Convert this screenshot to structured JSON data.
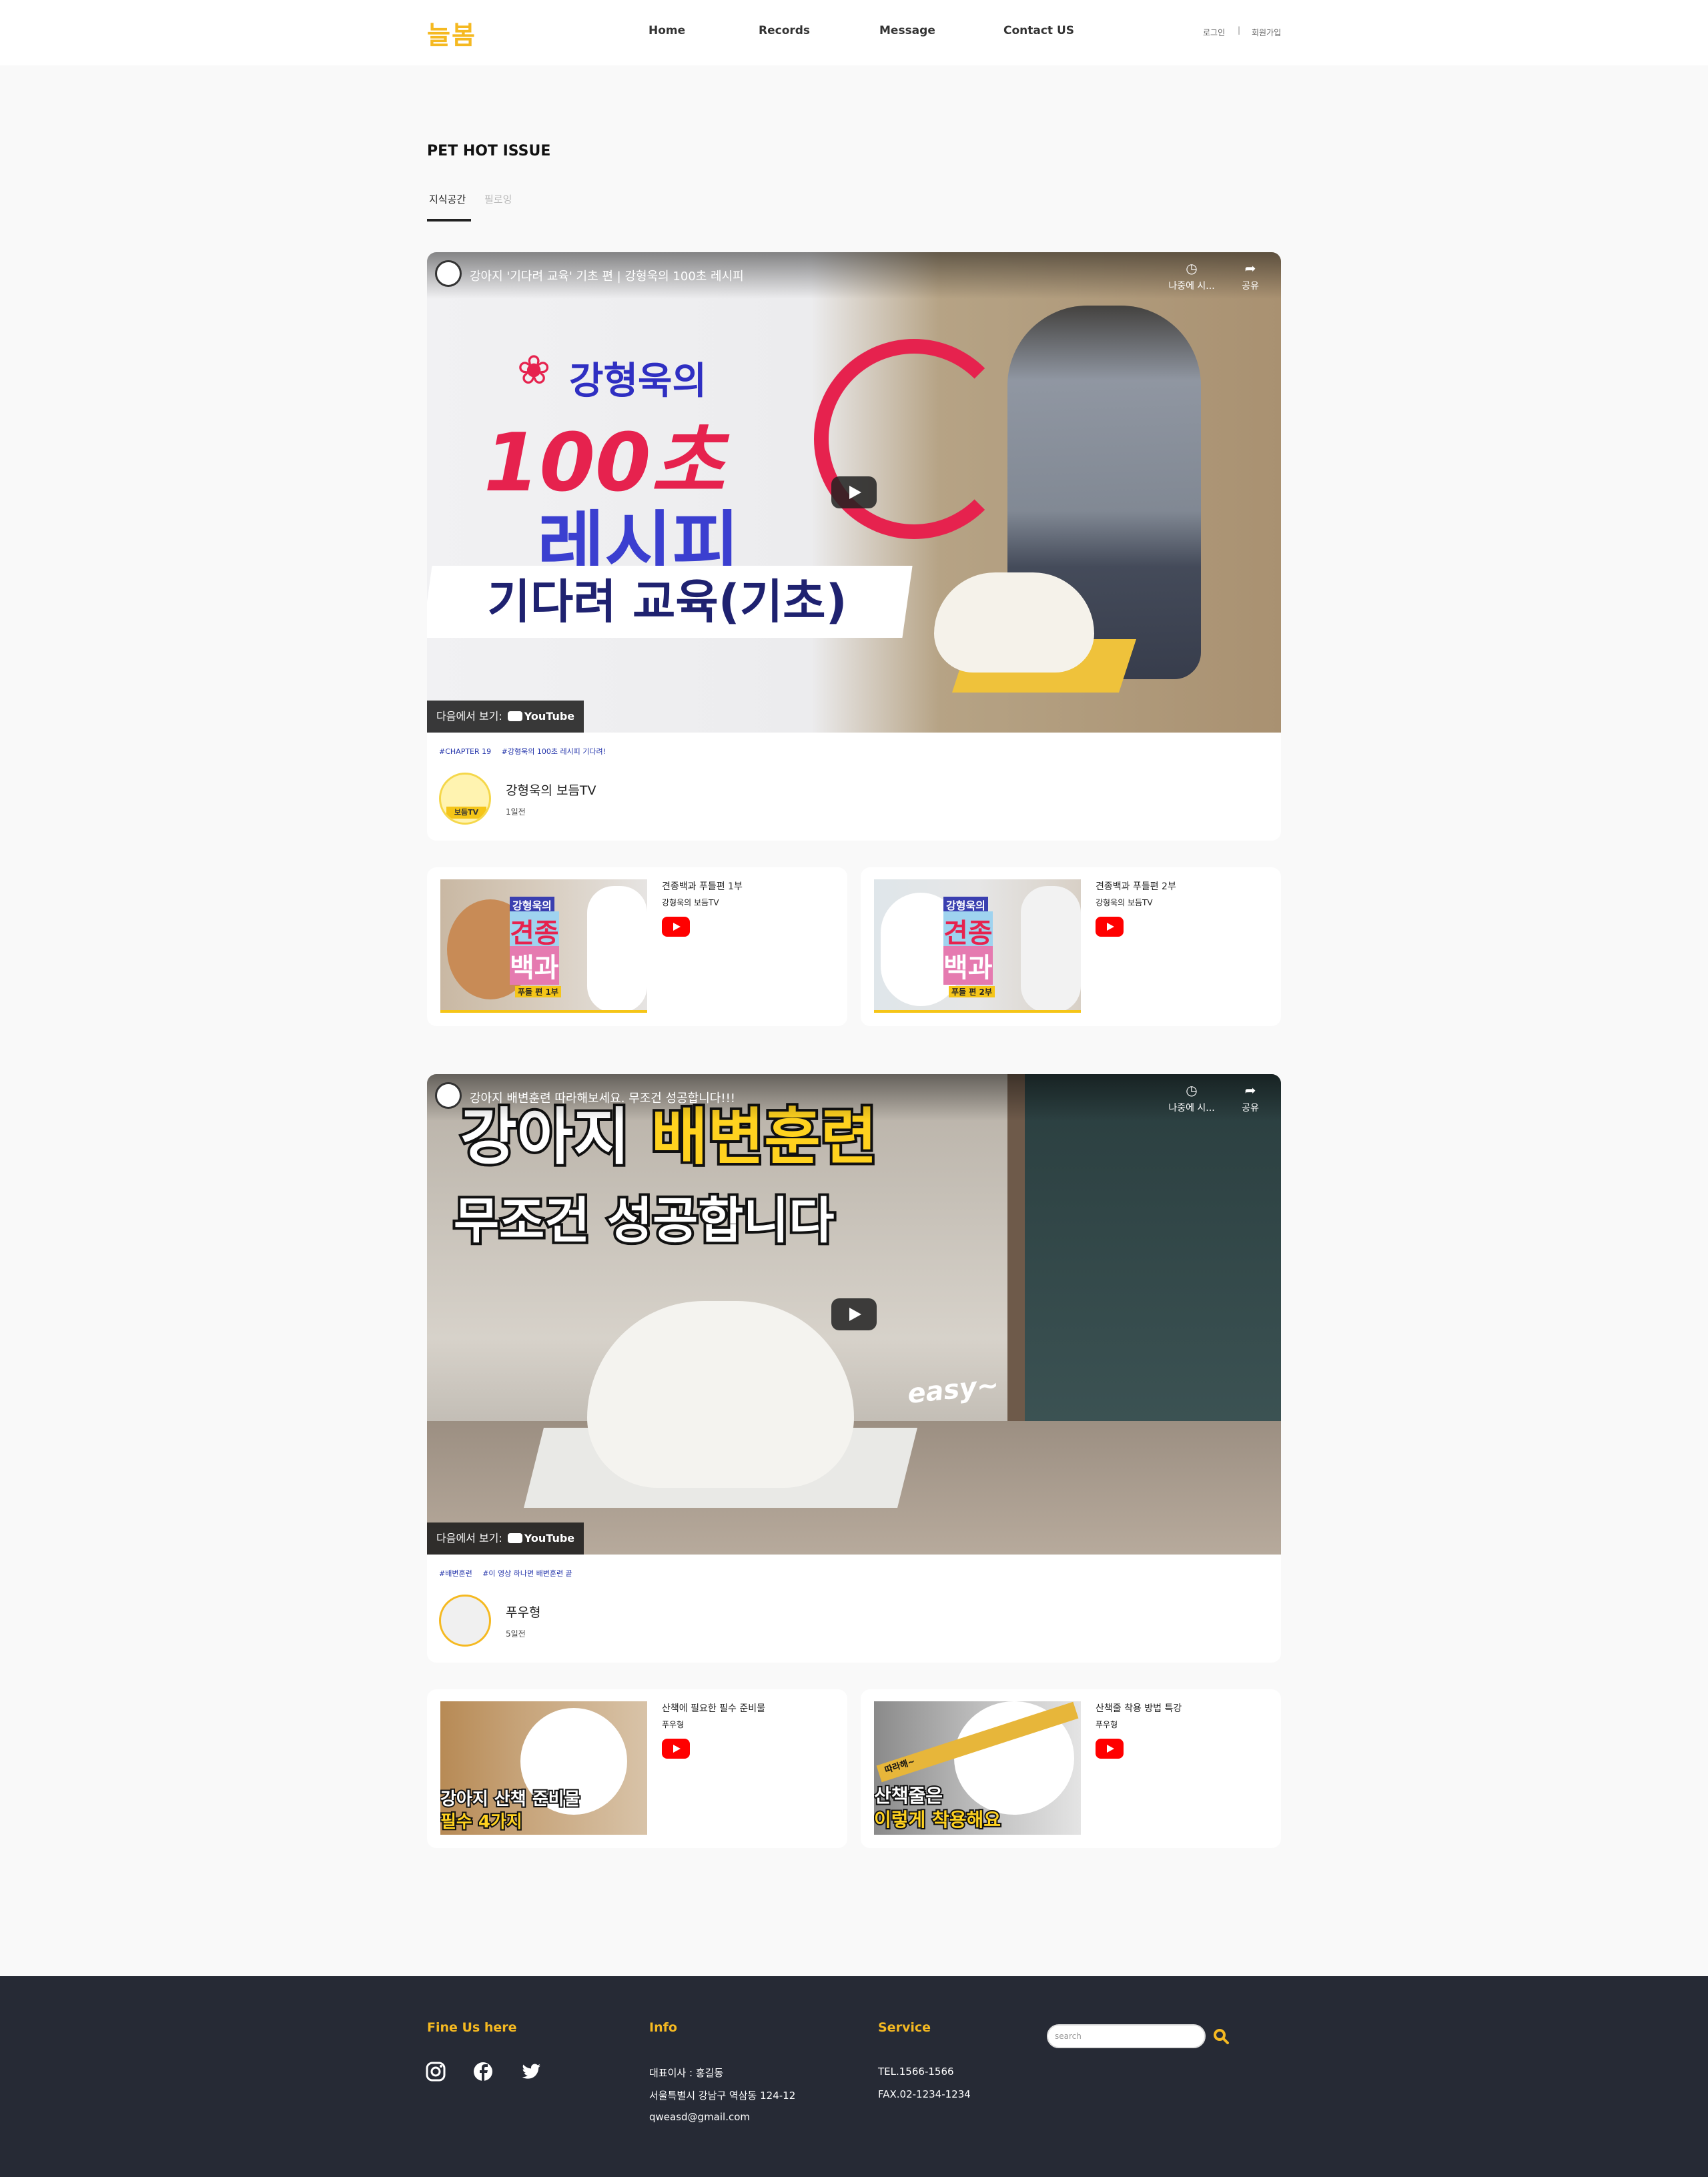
{
  "header": {
    "logo": "늘봄",
    "nav": [
      "Home",
      "Records",
      "Message",
      "Contact US"
    ],
    "login": "로그인",
    "separator": "|",
    "signup": "회원가입"
  },
  "section": {
    "title": "PET HOT ISSUE",
    "tabs": [
      {
        "label": "지식공간",
        "active": true
      },
      {
        "label": "필로잉",
        "active": false
      }
    ]
  },
  "videos": [
    {
      "title": "강아지 '기다려 교육' 기초 편 | 강형욱의 100초 레시피",
      "later_label": "나중에 시...",
      "share_label": "공유",
      "watch_on": "다음에서 보기:",
      "youtube_label": "YouTube",
      "thumbnail_text": [
        "강형욱의",
        "100초",
        "레시피",
        "기다려 교육(기초)"
      ],
      "tags": [
        "#CHAPTER 19",
        "#강형욱의 100초 레시피 기다려!"
      ],
      "channel": "강형욱의 보듬TV",
      "channel_badge": "보듬TV",
      "time": "1일전",
      "related": [
        {
          "title": "견종백과 푸들편 1부",
          "channel": "강형욱의 보듬TV",
          "thumb_a": "강형욱의",
          "thumb_b": "견종",
          "thumb_c": "백과",
          "thumb_d": "푸들 편 1부"
        },
        {
          "title": "견종백과 푸들편 2부",
          "channel": "강형욱의 보듬TV",
          "thumb_a": "강형욱의",
          "thumb_b": "견종",
          "thumb_c": "백과",
          "thumb_d": "푸들 편 2부"
        }
      ]
    },
    {
      "title": "강아지 배변훈련 따라해보세요. 무조건 성공합니다!!!",
      "later_label": "나중에 시...",
      "share_label": "공유",
      "watch_on": "다음에서 보기:",
      "youtube_label": "YouTube",
      "thumbnail_text": [
        "강아지",
        "배변훈련",
        "무조건 성공합니다",
        "easy~"
      ],
      "tags": [
        "#배변훈련",
        "#이 영상 하나면 배변훈련 끝"
      ],
      "channel": "푸우형",
      "time": "5일전",
      "related": [
        {
          "title": "산책에 필요한 필수 준비물",
          "channel": "푸우형",
          "thumb_a": "강아지 산책 준비물",
          "thumb_b": "필수 4가지"
        },
        {
          "title": "산책줄 착용 방법 특강",
          "channel": "푸우형",
          "thumb_a": "따라해~",
          "thumb_b": "산책줄은",
          "thumb_c": "이렇게 착용해요"
        }
      ]
    }
  ],
  "footer": {
    "find_title": "Fine Us here",
    "info_title": "Info",
    "info_lines": [
      "대표이사 : 홍길동",
      "서울특별시 강남구 역삼동 124-12",
      "qweasd@gmail.com"
    ],
    "service_title": "Service",
    "service_lines": [
      "TEL.1566-1566",
      "FAX.02-1234-1234"
    ],
    "search_placeholder": "search"
  },
  "colors": {
    "accent": "#f5b921",
    "footer_bg": "#262a35",
    "tag_blue": "#2233aa",
    "youtube_red": "#ff0000"
  }
}
